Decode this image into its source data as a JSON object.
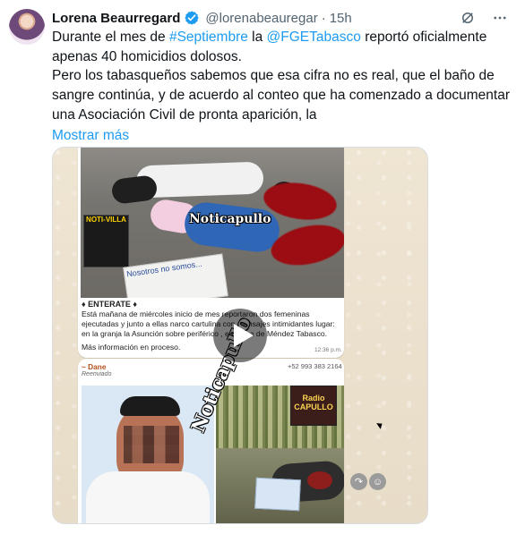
{
  "post": {
    "author_name": "Lorena Beaurregard",
    "handle": "@lorenabeauregar",
    "separator": "·",
    "time": "15h",
    "text": {
      "line1_a": "Durante el mes de ",
      "hashtag": "#Septiembre",
      "line1_b": " la ",
      "mention": "@FGETabasco",
      "line1_c": " reportó oficialmente",
      "line2": "apenas 40 homicidios dolosos.",
      "line3": "Pero los tabasqueños sabemos que esa cifra no es real, que el baño de",
      "line4": "sangre continúa, y de acuerdo al conteo que ha comenzado a documentar",
      "line5": "una Asociación Civil de pronta aparición, la",
      "show_more": "Mostrar más"
    }
  },
  "media": {
    "watermark_top": "Noticapullo",
    "logo_text": "NOTI-VILLA",
    "sign_text": "Nosotros no somos...",
    "headline": "♦ ENTERATE ♦",
    "message": "Está mañana de miércoles inicio de mes reportaron dos femeninas ejecutadas y junto a ellas narco cartulina con mensajes intimidantes lugar: en la granja la Asunción sobre periférico , en Jalpa de Méndez Tabasco.",
    "more_info": "Más información en proceso.",
    "msg_time": "12:36 p.m.",
    "sender": "~ Dane",
    "phone": "+52 993 383 2164",
    "forwarded": "Reenviado",
    "radio_text": "Radio CAPULLO",
    "watermark_bottom": "Noticapullo",
    "side_button_1": "↷",
    "side_button_2": "☺"
  },
  "colors": {
    "accent": "#1d9bf0",
    "text": "#0f1419",
    "muted": "#536471"
  }
}
